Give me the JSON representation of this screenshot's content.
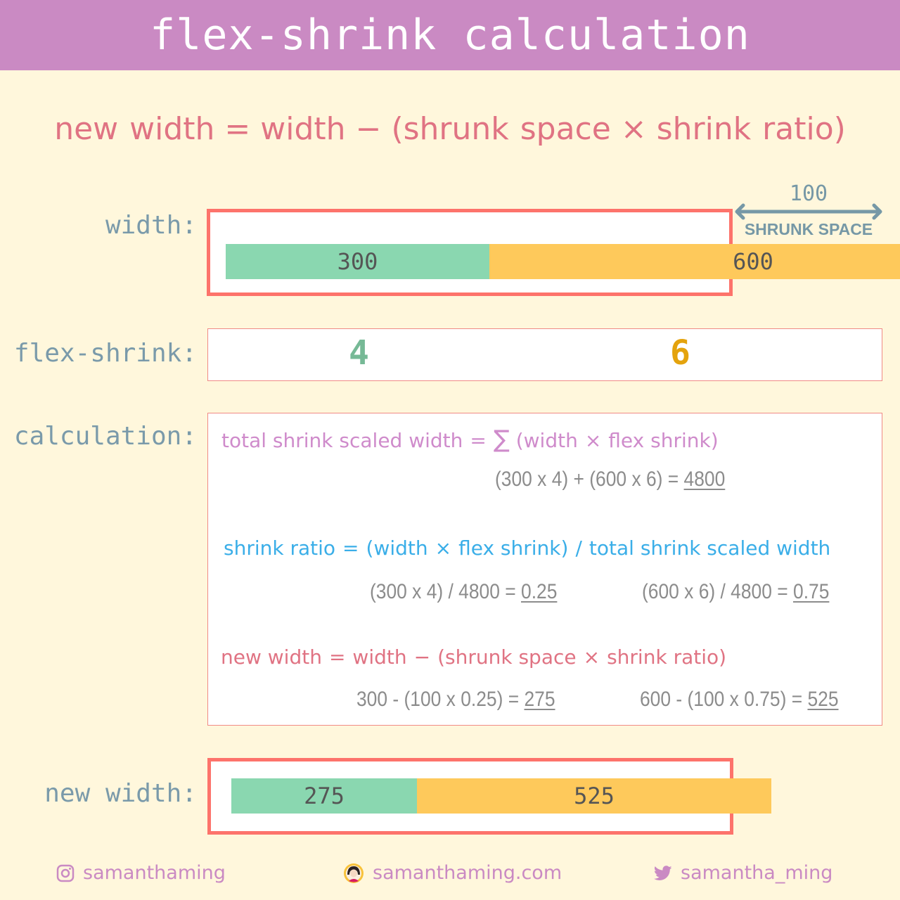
{
  "header": {
    "title": "flex-shrink calculation"
  },
  "formula": {
    "lhs": "new width",
    "eq": "=",
    "term1": "width",
    "minus": "−",
    "open": "(",
    "term2": "shrunk space",
    "times": "×",
    "term3": "shrink ratio",
    "close": ")"
  },
  "labels": {
    "width": "width:",
    "flex_shrink": "flex-shrink:",
    "calculation": "calculation:",
    "new_width": "new width:"
  },
  "width_row": {
    "items": [
      {
        "label": "300",
        "value": 300,
        "color": "#8ad7b0"
      },
      {
        "label": "600",
        "value": 600,
        "color": "#fec95b"
      }
    ],
    "container_width": 800,
    "shrunk_space_value": "100",
    "shrunk_space_label": "SHRUNK SPACE"
  },
  "flex_shrink_row": {
    "items": [
      {
        "label": "4",
        "color": "#76b996"
      },
      {
        "label": "6",
        "color": "#e4a30d"
      }
    ]
  },
  "calculation": {
    "total": {
      "lhs": "total shrink scaled width",
      "eq": "=",
      "sigma": "∑",
      "rhs_open": "(width",
      "times": "×",
      "rhs_close": "flex shrink)",
      "result_expr": "(300 x 4) + (600 x 6) = ",
      "result_value": "4800"
    },
    "ratio": {
      "lhs": "shrink ratio",
      "eq": "=",
      "rhs_open": "(width",
      "times": "×",
      "rhs_mid": "flex shrink)",
      "slash": "/",
      "rhs_end": "total shrink scaled width",
      "results": [
        {
          "expr": "(300 x 4) / 4800 = ",
          "value": "0.25"
        },
        {
          "expr": "(600 x 6) / 4800 = ",
          "value": "0.75"
        }
      ]
    },
    "new_width": {
      "lhs": "new width",
      "eq": "=",
      "term1": "width",
      "minus": "−",
      "open": "(shrunk space",
      "times": "×",
      "close": "shrink ratio)",
      "results": [
        {
          "expr": "300 - (100 x 0.25) = ",
          "value": "275"
        },
        {
          "expr": "600 - (100 x 0.75) = ",
          "value": "525"
        }
      ]
    }
  },
  "new_width_row": {
    "items": [
      {
        "label": "275",
        "value": 275,
        "color": "#8ad7b0"
      },
      {
        "label": "525",
        "value": 525,
        "color": "#fec95b"
      }
    ]
  },
  "footer": {
    "instagram": {
      "icon": "instagram-icon",
      "handle": "samanthaming"
    },
    "website": {
      "icon": "avatar-icon",
      "handle": "samanthaming.com"
    },
    "twitter": {
      "icon": "twitter-icon",
      "handle": "samantha_ming"
    }
  },
  "colors": {
    "header_bg": "#ca8ac3",
    "background": "#fff7dc",
    "border": "#fd736b",
    "green": "#8ad7b0",
    "yellow": "#fec95b",
    "label": "#7a9aaa"
  }
}
